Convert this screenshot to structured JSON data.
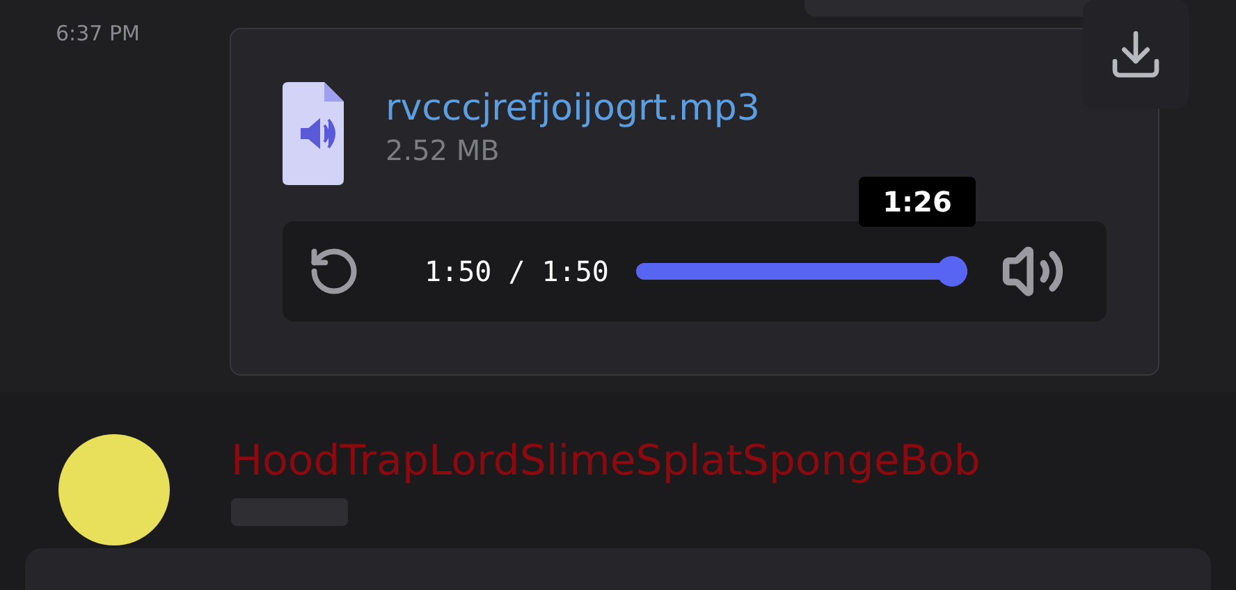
{
  "message": {
    "time": "6:37 PM",
    "attachment": {
      "file_name": "rvcccjrefjoijogrt.mp3",
      "file_size": "2.52 MB",
      "player": {
        "time": "1:50 / 1:50",
        "level": 1.0,
        "tooltip": "1:26"
      }
    }
  },
  "next_message": {
    "author": "HoodTrapLordSlimeSplatSpongeBob",
    "color": "#8b0a0f"
  }
}
